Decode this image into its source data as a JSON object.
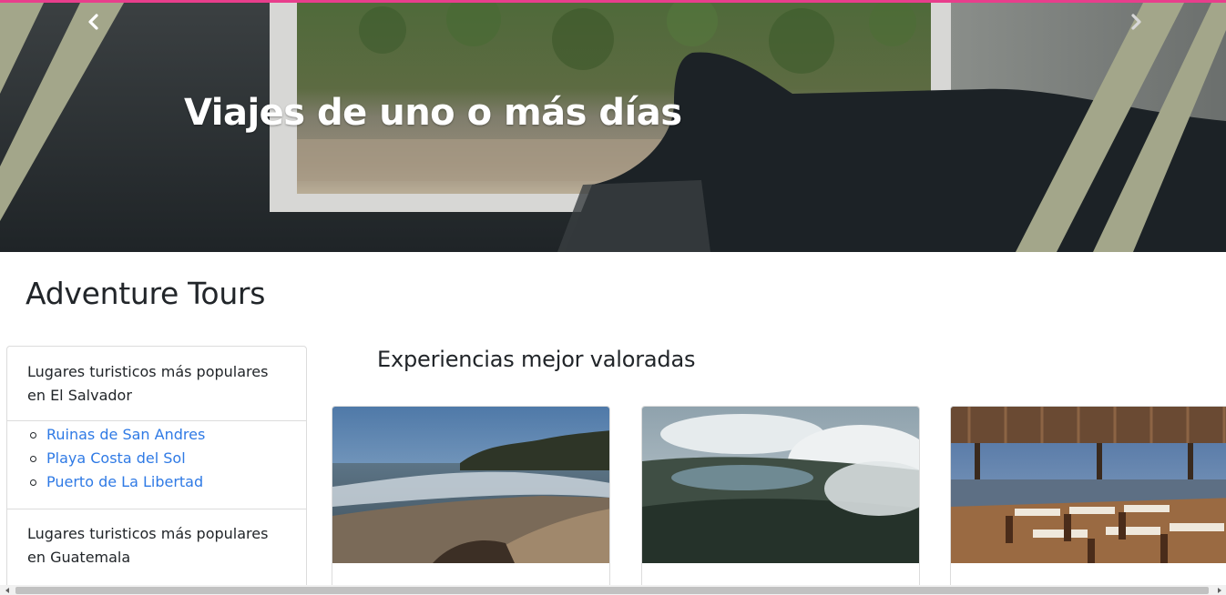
{
  "colors": {
    "accent": "#e83e8c",
    "link": "#2f7ae5",
    "text": "#212529",
    "stripe": "#a3a68a"
  },
  "carousel": {
    "caption": "Viajes de uno o más días",
    "prev_icon": "chevron-left-icon",
    "next_icon": "chevron-right-icon"
  },
  "brand": "Adventure Tours",
  "sidebar": {
    "sections": [
      {
        "title": "Lugares turisticos más populares en El Salvador",
        "items": [
          "Ruinas de San Andres",
          "Playa Costa del Sol",
          "Puerto de La Libertad"
        ]
      },
      {
        "title": "Lugares turisticos más populares en Guatemala",
        "items": []
      }
    ]
  },
  "experiences": {
    "title": "Experiencias mejor valoradas",
    "cards": [
      {
        "image": "beach-photo"
      },
      {
        "image": "crater-lake-photo"
      },
      {
        "image": "restaurant-photo"
      }
    ]
  }
}
